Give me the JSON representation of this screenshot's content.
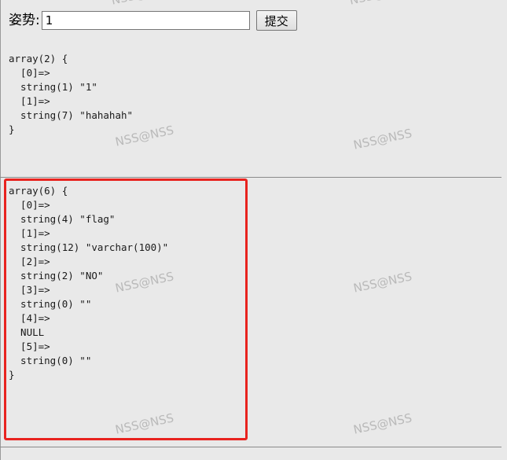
{
  "form": {
    "label": "姿势:",
    "input_value": "1",
    "submit_label": "提交"
  },
  "dumps": [
    "array(2) {\n  [0]=>\n  string(1) \"1\"\n  [1]=>\n  string(7) \"hahahah\"\n}",
    "array(6) {\n  [0]=>\n  string(4) \"flag\"\n  [1]=>\n  string(12) \"varchar(100)\"\n  [2]=>\n  string(2) \"NO\"\n  [3]=>\n  string(0) \"\"\n  [4]=>\n  NULL\n  [5]=>\n  string(0) \"\"\n}"
  ],
  "watermark": "NSS@NSS",
  "colors": {
    "highlight": "#e8231f",
    "background": "#e9e9e9"
  }
}
